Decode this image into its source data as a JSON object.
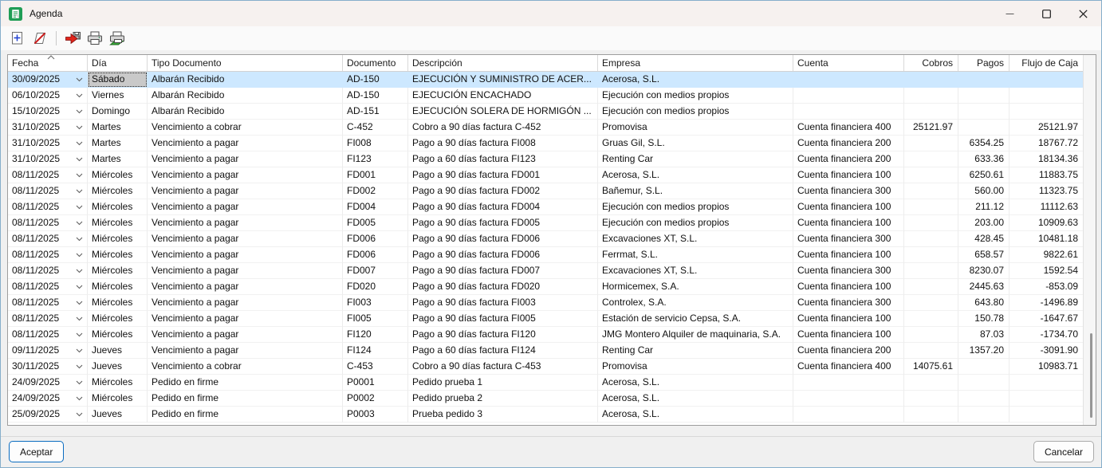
{
  "window": {
    "title": "Agenda",
    "controls": [
      {
        "icon": "minimize-icon"
      },
      {
        "icon": "maximize-icon"
      },
      {
        "icon": "close-icon"
      }
    ]
  },
  "toolbar": {
    "buttons": [
      {
        "icon": "new-record-icon"
      },
      {
        "icon": "delete-record-icon"
      },
      {
        "icon": "export-save-icon"
      },
      {
        "icon": "print-icon"
      },
      {
        "icon": "print-alt-icon"
      }
    ]
  },
  "table": {
    "sorted_column": "Fecha",
    "sort_direction": "asc",
    "selected_row_index": 0,
    "focused_field": "dia",
    "columns": [
      {
        "label": "Fecha"
      },
      {
        "label": "Día"
      },
      {
        "label": "Tipo Documento"
      },
      {
        "label": "Documento"
      },
      {
        "label": "Descripción"
      },
      {
        "label": "Empresa"
      },
      {
        "label": "Cuenta"
      },
      {
        "label": "Cobros"
      },
      {
        "label": "Pagos"
      },
      {
        "label": "Flujo de Caja"
      }
    ],
    "rows": [
      {
        "fecha": "30/09/2025",
        "dia": "Sábado",
        "tipo": "Albarán Recibido",
        "documento": "AD-150",
        "descripcion": "EJECUCIÓN Y SUMINISTRO DE ACER...",
        "empresa": "Acerosa, S.L.",
        "cuenta": "",
        "cobros": "",
        "pagos": "",
        "flujo": ""
      },
      {
        "fecha": "06/10/2025",
        "dia": "Viernes",
        "tipo": "Albarán Recibido",
        "documento": "AD-150",
        "descripcion": "EJECUCIÓN ENCACHADO",
        "empresa": "Ejecución con medios propios",
        "cuenta": "",
        "cobros": "",
        "pagos": "",
        "flujo": ""
      },
      {
        "fecha": "15/10/2025",
        "dia": "Domingo",
        "tipo": "Albarán Recibido",
        "documento": "AD-151",
        "descripcion": "EJECUCIÓN SOLERA DE HORMIGÓN ...",
        "empresa": "Ejecución con medios propios",
        "cuenta": "",
        "cobros": "",
        "pagos": "",
        "flujo": ""
      },
      {
        "fecha": "31/10/2025",
        "dia": "Martes",
        "tipo": "Vencimiento a cobrar",
        "documento": "C-452",
        "descripcion": "Cobro a 90 días factura C-452",
        "empresa": "Promovisa",
        "cuenta": "Cuenta financiera 400",
        "cobros": "25121.97",
        "pagos": "",
        "flujo": "25121.97"
      },
      {
        "fecha": "31/10/2025",
        "dia": "Martes",
        "tipo": "Vencimiento a pagar",
        "documento": "FI008",
        "descripcion": "Pago a 90 días factura FI008",
        "empresa": "Gruas Gil, S.L.",
        "cuenta": "Cuenta financiera 200",
        "cobros": "",
        "pagos": "6354.25",
        "flujo": "18767.72"
      },
      {
        "fecha": "31/10/2025",
        "dia": "Martes",
        "tipo": "Vencimiento a pagar",
        "documento": "FI123",
        "descripcion": "Pago a 60 días factura FI123",
        "empresa": "Renting Car",
        "cuenta": "Cuenta financiera 200",
        "cobros": "",
        "pagos": "633.36",
        "flujo": "18134.36"
      },
      {
        "fecha": "08/11/2025",
        "dia": "Miércoles",
        "tipo": "Vencimiento a pagar",
        "documento": "FD001",
        "descripcion": "Pago a 90 días factura FD001",
        "empresa": "Acerosa, S.L.",
        "cuenta": "Cuenta financiera 100",
        "cobros": "",
        "pagos": "6250.61",
        "flujo": "11883.75"
      },
      {
        "fecha": "08/11/2025",
        "dia": "Miércoles",
        "tipo": "Vencimiento a pagar",
        "documento": "FD002",
        "descripcion": "Pago a 90 días factura FD002",
        "empresa": "Bañemur, S.L.",
        "cuenta": "Cuenta financiera 300",
        "cobros": "",
        "pagos": "560.00",
        "flujo": "11323.75"
      },
      {
        "fecha": "08/11/2025",
        "dia": "Miércoles",
        "tipo": "Vencimiento a pagar",
        "documento": "FD004",
        "descripcion": "Pago a 90 días factura FD004",
        "empresa": "Ejecución con medios propios",
        "cuenta": "Cuenta financiera 100",
        "cobros": "",
        "pagos": "211.12",
        "flujo": "11112.63"
      },
      {
        "fecha": "08/11/2025",
        "dia": "Miércoles",
        "tipo": "Vencimiento a pagar",
        "documento": "FD005",
        "descripcion": "Pago a 90 días factura FD005",
        "empresa": "Ejecución con medios propios",
        "cuenta": "Cuenta financiera 100",
        "cobros": "",
        "pagos": "203.00",
        "flujo": "10909.63"
      },
      {
        "fecha": "08/11/2025",
        "dia": "Miércoles",
        "tipo": "Vencimiento a pagar",
        "documento": "FD006",
        "descripcion": "Pago a 90 días factura FD006",
        "empresa": "Excavaciones XT, S.L.",
        "cuenta": "Cuenta financiera 300",
        "cobros": "",
        "pagos": "428.45",
        "flujo": "10481.18"
      },
      {
        "fecha": "08/11/2025",
        "dia": "Miércoles",
        "tipo": "Vencimiento a pagar",
        "documento": "FD006",
        "descripcion": "Pago a 90 días factura FD006",
        "empresa": "Ferrmat, S.L.",
        "cuenta": "Cuenta financiera 100",
        "cobros": "",
        "pagos": "658.57",
        "flujo": "9822.61"
      },
      {
        "fecha": "08/11/2025",
        "dia": "Miércoles",
        "tipo": "Vencimiento a pagar",
        "documento": "FD007",
        "descripcion": "Pago a 90 días factura FD007",
        "empresa": "Excavaciones XT, S.L.",
        "cuenta": "Cuenta financiera 300",
        "cobros": "",
        "pagos": "8230.07",
        "flujo": "1592.54"
      },
      {
        "fecha": "08/11/2025",
        "dia": "Miércoles",
        "tipo": "Vencimiento a pagar",
        "documento": "FD020",
        "descripcion": "Pago a 90 días factura FD020",
        "empresa": "Hormicemex, S.A.",
        "cuenta": "Cuenta financiera 100",
        "cobros": "",
        "pagos": "2445.63",
        "flujo": "-853.09"
      },
      {
        "fecha": "08/11/2025",
        "dia": "Miércoles",
        "tipo": "Vencimiento a pagar",
        "documento": "FI003",
        "descripcion": "Pago a 90 días factura FI003",
        "empresa": "Controlex, S.A.",
        "cuenta": "Cuenta financiera 300",
        "cobros": "",
        "pagos": "643.80",
        "flujo": "-1496.89"
      },
      {
        "fecha": "08/11/2025",
        "dia": "Miércoles",
        "tipo": "Vencimiento a pagar",
        "documento": "FI005",
        "descripcion": "Pago a 90 días factura FI005",
        "empresa": "Estación de servicio Cepsa, S.A.",
        "cuenta": "Cuenta financiera 100",
        "cobros": "",
        "pagos": "150.78",
        "flujo": "-1647.67"
      },
      {
        "fecha": "08/11/2025",
        "dia": "Miércoles",
        "tipo": "Vencimiento a pagar",
        "documento": "FI120",
        "descripcion": "Pago a 90 días factura FI120",
        "empresa": "JMG Montero Alquiler de maquinaria, S.A.",
        "cuenta": "Cuenta financiera 100",
        "cobros": "",
        "pagos": "87.03",
        "flujo": "-1734.70"
      },
      {
        "fecha": "09/11/2025",
        "dia": "Jueves",
        "tipo": "Vencimiento a pagar",
        "documento": "FI124",
        "descripcion": "Pago a 60 días factura FI124",
        "empresa": "Renting Car",
        "cuenta": "Cuenta financiera 200",
        "cobros": "",
        "pagos": "1357.20",
        "flujo": "-3091.90"
      },
      {
        "fecha": "30/11/2025",
        "dia": "Jueves",
        "tipo": "Vencimiento a cobrar",
        "documento": "C-453",
        "descripcion": "Cobro a 90 días factura C-453",
        "empresa": "Promovisa",
        "cuenta": "Cuenta financiera 400",
        "cobros": "14075.61",
        "pagos": "",
        "flujo": "10983.71"
      },
      {
        "fecha": "24/09/2025",
        "dia": "Miércoles",
        "tipo": "Pedido en firme",
        "documento": "P0001",
        "descripcion": "Pedido prueba 1",
        "empresa": "Acerosa, S.L.",
        "cuenta": "",
        "cobros": "",
        "pagos": "",
        "flujo": ""
      },
      {
        "fecha": "24/09/2025",
        "dia": "Miércoles",
        "tipo": "Pedido en firme",
        "documento": "P0002",
        "descripcion": "Pedido prueba 2",
        "empresa": "Acerosa, S.L.",
        "cuenta": "",
        "cobros": "",
        "pagos": "",
        "flujo": ""
      },
      {
        "fecha": "25/09/2025",
        "dia": "Jueves",
        "tipo": "Pedido en firme",
        "documento": "P0003",
        "descripcion": "Prueba pedido 3",
        "empresa": "Acerosa, S.L.",
        "cuenta": "",
        "cobros": "",
        "pagos": "",
        "flujo": ""
      }
    ]
  },
  "footer": {
    "accept_label": "Aceptar",
    "cancel_label": "Cancelar"
  },
  "colors": {
    "selection_blue": "#cde8ff",
    "focused_cell_gray": "#c9c9c9",
    "accept_border_blue": "#0a6cc0",
    "app_icon_green": "#1f9d55",
    "titlebar_bg": "#f6f1ef"
  }
}
